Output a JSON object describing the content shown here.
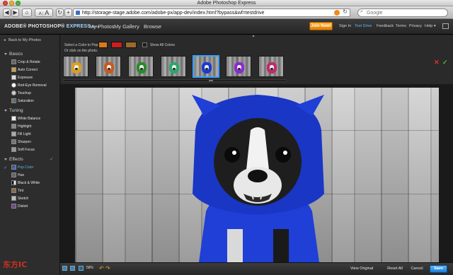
{
  "window": {
    "title": "Adobe Photoshop Express"
  },
  "browser": {
    "url": "http://storage-stage.adobe.com/adobe-px/app-dev/index.html?bypass&wf=testdrive",
    "search_placeholder": "Google",
    "font_small": "A",
    "font_large": "A"
  },
  "app": {
    "logo_brand": "ADOBE® PHOTOSHOP®",
    "logo_product": "EXPRESS",
    "logo_beta": "BETA",
    "nav": [
      "My Photos",
      "My Gallery",
      "Browse"
    ],
    "join_label": "Join Now!",
    "header_links": [
      "Sign In",
      "Test Drive",
      "Feedback",
      "Terms",
      "Privacy",
      "Help ▾"
    ],
    "active_header_link": "Test Drive"
  },
  "sidebar": {
    "back_label": "Back to My Photos",
    "sections": [
      {
        "title": "Basics",
        "items": [
          "Crop & Rotate",
          "Auto Correct",
          "Exposure",
          "Red-Eye Removal",
          "Touchup",
          "Saturation"
        ]
      },
      {
        "title": "Tuning",
        "items": [
          "White Balance",
          "Highlight",
          "Fill Light",
          "Sharpen",
          "Soft Focus"
        ]
      },
      {
        "title": "Effects",
        "items": [
          "Pop Color",
          "Hue",
          "Black & White",
          "Tint",
          "Sketch",
          "Distort"
        ]
      }
    ],
    "selected_item": "Pop Color",
    "check_mark": "✓"
  },
  "pop_color_panel": {
    "select_label": "Select a Color to Pop:",
    "click_label": "Or click on the photo.",
    "show_all_label": "Show All Colors",
    "swatch_colors": [
      "#d9791c",
      "#c81e1e",
      "#9b6a2d"
    ],
    "thumbnail_colors": [
      "#d8a020",
      "#c85a1a",
      "#2a8a2a",
      "#2aa86a",
      "#1a3ad0",
      "#8a2ad0",
      "#c02a6a"
    ],
    "selected_thumbnail": 4,
    "cancel_glyph": "✕",
    "ok_glyph": "✓"
  },
  "photo": {
    "accent_color": "#1f3fd6"
  },
  "bottom": {
    "zoom": "58%",
    "undo_glyph": "↶",
    "redo_glyph": "↷",
    "view_original_label": "View Original",
    "reset_label": "Reset All",
    "cancel_label": "Cancel",
    "save_label": "Save"
  },
  "watermark": {
    "text": "东方IC"
  }
}
